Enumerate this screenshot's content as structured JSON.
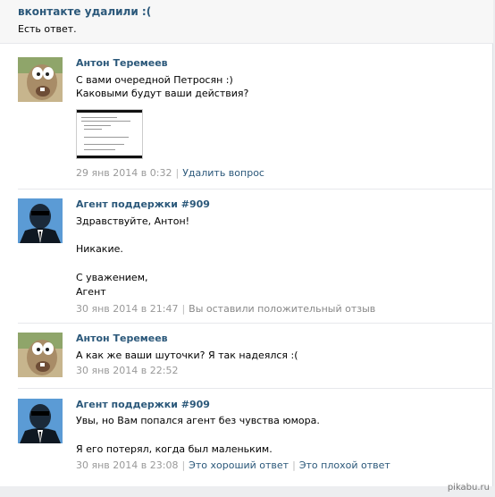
{
  "question": {
    "title": "вконтакте удалили :(",
    "status": "Есть ответ."
  },
  "messages": [
    {
      "author": "Антон Теремеев",
      "avatar_icon": "ice-age-sloth-avatar",
      "lines": [
        "С вами очередной Петросян :)",
        "Каковыми будут ваши действия?"
      ],
      "attachment": "screenshot-thumbnail",
      "date": "29 янв 2014 в 0:32",
      "actions": [
        "Удалить вопрос"
      ]
    },
    {
      "author": "Агент поддержки #909",
      "avatar_icon": "support-agent-avatar",
      "lines": [
        "Здравствуйте, Антон!",
        "Никакие.",
        "С уважением,",
        "Агент"
      ],
      "date": "30 янв 2014 в 21:47",
      "note": "Вы оставили положительный отзыв"
    },
    {
      "author": "Антон Теремеев",
      "avatar_icon": "ice-age-sloth-avatar",
      "lines": [
        "А как же ваши шуточки? Я так надеялся :("
      ],
      "date": "30 янв 2014 в 22:52"
    },
    {
      "author": "Агент поддержки #909",
      "avatar_icon": "support-agent-avatar",
      "lines": [
        "Увы, но Вам попался агент без чувства юмора.",
        "Я его потерял, когда был маленьким."
      ],
      "date": "30 янв 2014 в 23:08",
      "actions": [
        "Это хороший ответ",
        "Это плохой ответ"
      ]
    }
  ],
  "watermark": "pikabu.ru",
  "colors": {
    "link": "#2b587a",
    "muted": "#999999",
    "header_bg": "#f7f7f7",
    "agent_avatar_bg": "#5b9bd5"
  }
}
